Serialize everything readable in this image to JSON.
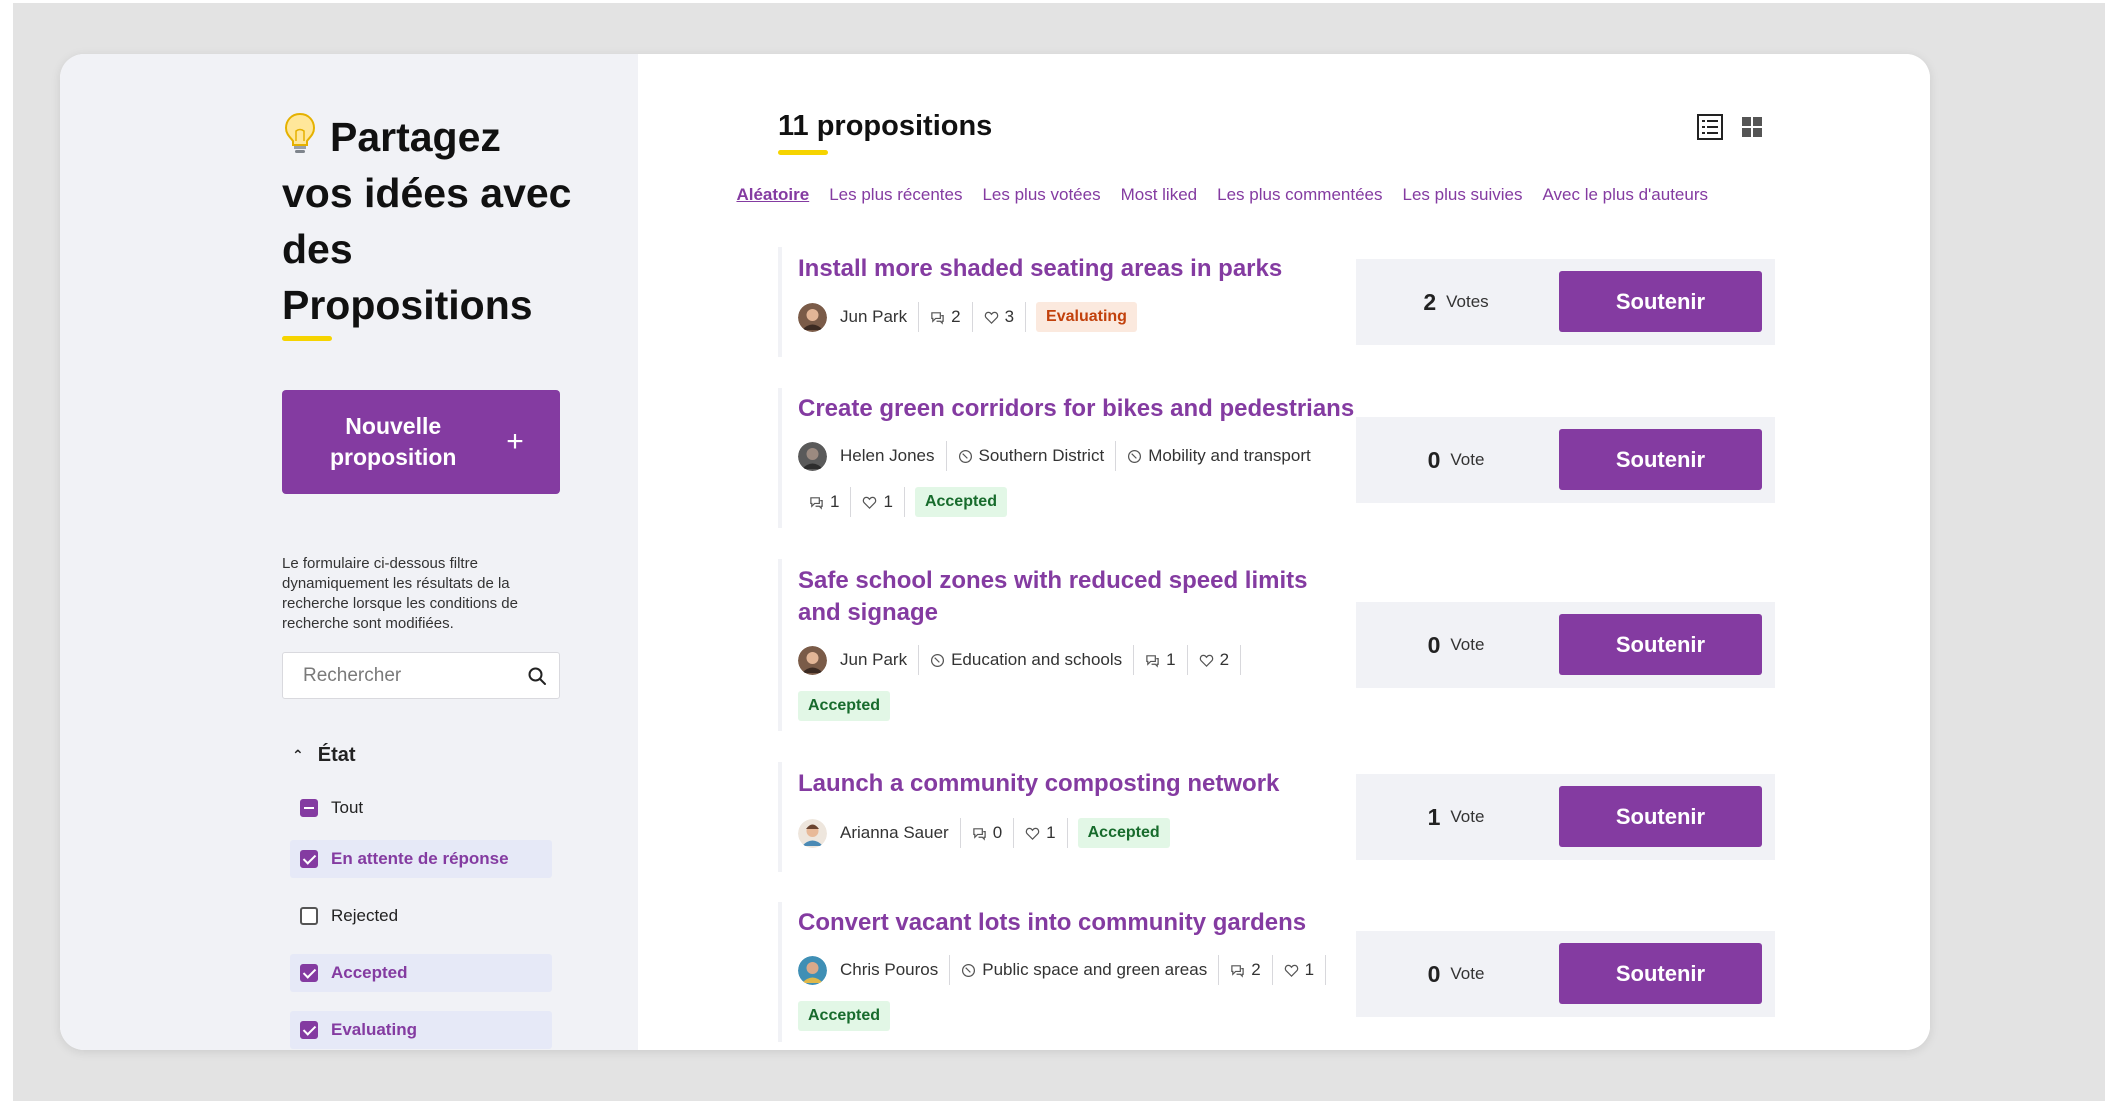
{
  "sidebar": {
    "title": "Partagez vos idées avec des Propositions",
    "new_button": "Nouvelle proposition",
    "new_button_icon": "+",
    "help_text": "Le formulaire ci-dessous filtre dynamiquement les résultats de la recherche lorsque les conditions de recherche sont modifiées.",
    "search_placeholder": "Rechercher",
    "filter": {
      "title": "État",
      "options": [
        {
          "label": "Tout",
          "state": "indeterminate"
        },
        {
          "label": "En attente de réponse",
          "state": "checked"
        },
        {
          "label": "Rejected",
          "state": "unchecked"
        },
        {
          "label": "Accepted",
          "state": "checked"
        },
        {
          "label": "Evaluating",
          "state": "checked"
        }
      ]
    }
  },
  "main": {
    "count_label": "11 propositions",
    "sorts": [
      "Aléatoire",
      "Les plus récentes",
      "Les plus votées",
      "Most liked",
      "Les plus commentées",
      "Les plus suivies",
      "Avec le plus d'auteurs"
    ],
    "active_sort": "Aléatoire",
    "proposals": [
      {
        "title": "Install more shaded seating areas in parks",
        "author": "Jun Park",
        "scope": "",
        "category": "",
        "comments": "2",
        "likes": "3",
        "status": "Evaluating",
        "votes": "2",
        "vote_label": "Votes",
        "button": "Soutenir"
      },
      {
        "title": "Create green corridors for bikes and pedestrians",
        "author": "Helen Jones",
        "scope": "Southern District",
        "category": "Mobility and transport",
        "comments": "1",
        "likes": "1",
        "status": "Accepted",
        "votes": "0",
        "vote_label": "Vote",
        "button": "Soutenir"
      },
      {
        "title": "Safe school zones with reduced speed limits and signage",
        "author": "Jun Park",
        "scope": "",
        "category": "Education and schools",
        "comments": "1",
        "likes": "2",
        "status": "Accepted",
        "votes": "0",
        "vote_label": "Vote",
        "button": "Soutenir"
      },
      {
        "title": "Launch a community composting network",
        "author": "Arianna Sauer",
        "scope": "",
        "category": "",
        "comments": "0",
        "likes": "1",
        "status": "Accepted",
        "votes": "1",
        "vote_label": "Vote",
        "button": "Soutenir"
      },
      {
        "title": "Convert vacant lots into community gardens",
        "author": "Chris Pouros",
        "scope": "",
        "category": "Public space and green areas",
        "comments": "2",
        "likes": "1",
        "status": "Accepted",
        "votes": "0",
        "vote_label": "Vote",
        "button": "Soutenir"
      }
    ]
  },
  "colors": {
    "accent": "#843ba1",
    "highlight": "#f6d400",
    "sidebar_bg": "#f1f2f6",
    "accepted_bg": "#e2f7e6",
    "evaluating_bg": "#fbe9de"
  }
}
